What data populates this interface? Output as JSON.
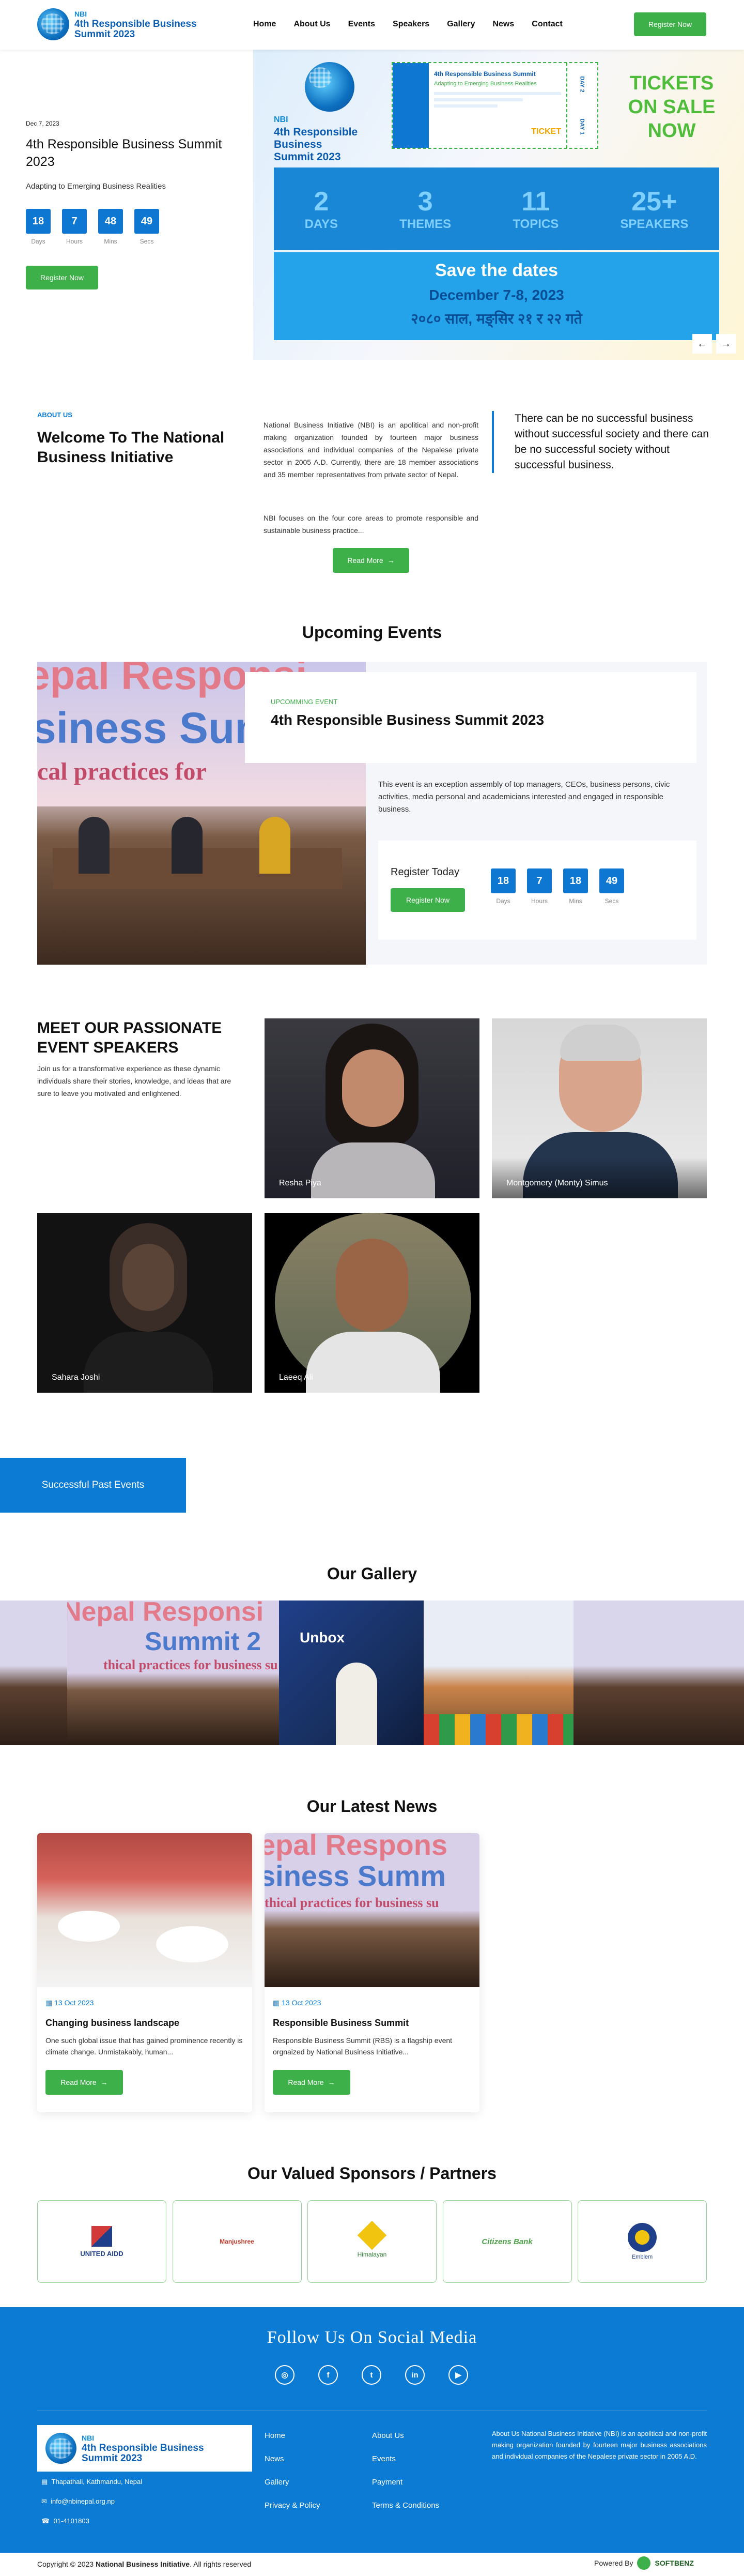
{
  "header": {
    "logo_line1": "NBI",
    "logo_line2": "4th Responsible Business",
    "logo_line3": "Summit 2023",
    "nav": [
      "Home",
      "About Us",
      "Events",
      "Speakers",
      "Gallery",
      "News",
      "Contact"
    ],
    "register_label": "Register Now"
  },
  "hero": {
    "date": "Dec 7, 2023",
    "title": "4th Responsible Business Summit 2023",
    "subtitle": "Adapting to Emerging Business Realities",
    "countdown": [
      {
        "value": "18",
        "label": "Days"
      },
      {
        "value": "7",
        "label": "Hours"
      },
      {
        "value": "48",
        "label": "Mins"
      },
      {
        "value": "49",
        "label": "Secs"
      }
    ],
    "register_label": "Register Now",
    "banner": {
      "logo_line1": "NBI",
      "logo_line2": "4th Responsible",
      "logo_line3": "Business",
      "logo_line4": "Summit 2023",
      "ticket_title": "4th Responsible Business Summit",
      "ticket_sub": "Adapting to Emerging Business Realities",
      "ticket_word": "TICKET",
      "ticket_day1": "DAY 1",
      "ticket_day2": "DAY 2",
      "tickets_line1": "TICKETS",
      "tickets_line2": "ON SALE",
      "tickets_line3": "NOW",
      "stats": [
        {
          "num": "2",
          "label": "DAYS"
        },
        {
          "num": "3",
          "label": "THEMES"
        },
        {
          "num": "11",
          "label": "TOPICS"
        },
        {
          "num": "25+",
          "label": "SPEAKERS"
        }
      ],
      "save_dates": "Save the dates",
      "dates_en": "December 7-8, 2023",
      "dates_np": "२०८० साल, मङ्सिर २१ र २२ गते"
    },
    "prev_arrow": "←",
    "next_arrow": "→"
  },
  "about": {
    "eyebrow": "ABOUT US",
    "title": "Welcome To The National Business Initiative",
    "para1": "National Business Initiative (NBI) is an apolitical and non-profit making organization founded by fourteen major business associations and individual companies of the Nepalese private sector in 2005 A.D. Currently, there are 18 member associations and 35 member representatives from private sector of Nepal.",
    "para2": "NBI focuses on the four core areas to promote responsible and sustainable business practice...",
    "read_more": "Read More",
    "quote": "There can be no successful business without successful society and there can be no successful society without successful business."
  },
  "events": {
    "title": "Upcoming Events",
    "eyebrow": "UPCOMMING EVENT",
    "event_title": "4th Responsible Business Summit 2023",
    "description": "This event is an exception assembly of top managers, CEOs, business persons, civic activities, media personal and academicians interested and engaged in responsible business.",
    "register_today": "Register Today",
    "register_label": "Register Now",
    "countdown": [
      {
        "value": "18",
        "label": "Days"
      },
      {
        "value": "7",
        "label": "Hours"
      },
      {
        "value": "18",
        "label": "Mins"
      },
      {
        "value": "49",
        "label": "Secs"
      }
    ],
    "banner_line1": "epal Responsi",
    "banner_line2": "siness Sum",
    "banner_line3": "cal practices for"
  },
  "speakers": {
    "title": "MEET OUR PASSIONATE EVENT SPEAKERS",
    "intro": "Join us for a transformative experience as these dynamic individuals share their stories, knowledge, and ideas that are sure to leave you motivated and enlightened.",
    "people": [
      {
        "name": "Resha Piya"
      },
      {
        "name": "Montgomery (Monty) Simus"
      },
      {
        "name": "Sahara Joshi"
      },
      {
        "name": "Laeeq Ali"
      }
    ]
  },
  "past_events": {
    "label": "Successful Past Events"
  },
  "gallery": {
    "title": "Our Gallery",
    "banner_a": "Nepal Responsi",
    "banner_b": "Summit 2",
    "banner_c": "thical practices for business su",
    "unbox": "Unbox"
  },
  "news": {
    "title": "Our Latest News",
    "items": [
      {
        "date": "13 Oct 2023",
        "title": "Changing business landscape",
        "excerpt": "One such global issue that has gained prominence recently is climate change. Unmistakably, human...",
        "read_more": "Read More"
      },
      {
        "date": "13 Oct 2023",
        "title": "Responsible Business Summit",
        "excerpt": "Responsible Business Summit (RBS) is a flagship event orgnaized by National Business Initiative...",
        "read_more": "Read More"
      }
    ],
    "img_line1": "epal Respons",
    "img_line2": "siness Summ",
    "img_line3": "thical practices for business su"
  },
  "sponsors": {
    "title": "Our Valued Sponsors / Partners",
    "items": [
      "UNITED AIDD",
      "Manjushree",
      "Himalayan",
      "Citizens Bank",
      "Emblem"
    ]
  },
  "footer": {
    "follow": "Follow Us On Social Media",
    "socials": [
      "instagram-icon",
      "facebook-icon",
      "twitter-icon",
      "linkedin-icon",
      "youtube-icon"
    ],
    "social_glyphs": [
      "◎",
      "f",
      "t",
      "in",
      "▶"
    ],
    "logo_line1": "NBI",
    "logo_line2": "4th Responsible Business",
    "logo_line3": "Summit 2023",
    "address": "Thapathali, Kathmandu, Nepal",
    "email": "info@nbinepal.org.np",
    "phone": "01-4101803",
    "links_col1": [
      "Home",
      "News",
      "Gallery",
      "Privacy & Policy"
    ],
    "links_col2": [
      "About Us",
      "Events",
      "Payment",
      "Terms & Conditions"
    ],
    "about": "About Us National Business Initiative (NBI) is an apolitical and non-profit making organization founded by fourteen major business associations and individual companies of the Nepalese private sector in 2005 A.D.",
    "copyright_prefix": "Copyright © 2023",
    "copyright_name": "National Business Initiative",
    "copyright_suffix": ". All rights reserved",
    "powered_by": "Powered By",
    "powered_name": "SOFTBENZ"
  },
  "colors": {
    "primary_blue": "#0b7bd3",
    "accent_green": "#3eb049",
    "dark_text": "#111111"
  }
}
